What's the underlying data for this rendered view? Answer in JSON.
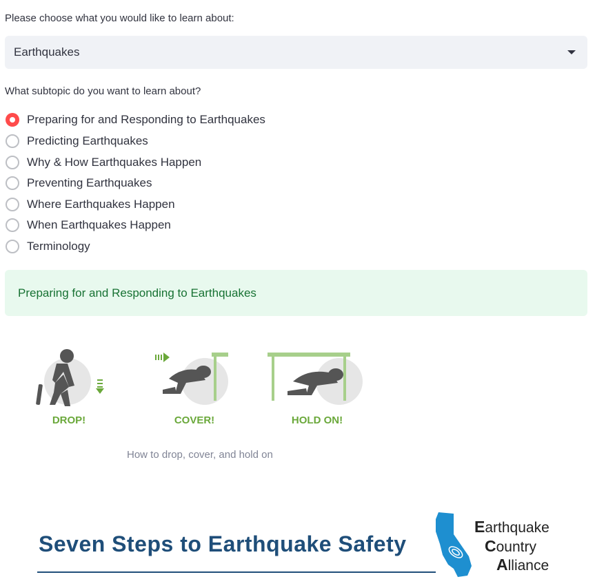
{
  "topic_select": {
    "label": "Please choose what you would like to learn about:",
    "value": "Earthquakes"
  },
  "subtopic": {
    "label": "What subtopic do you want to learn about?",
    "options": [
      "Preparing for and Responding to Earthquakes",
      "Predicting Earthquakes",
      "Why & How Earthquakes Happen",
      "Preventing Earthquakes",
      "Where Earthquakes Happen",
      "When Earthquakes Happen",
      "Terminology"
    ],
    "selected": "Preparing for and Responding to Earthquakes"
  },
  "success_message": "Preparing for and Responding to Earthquakes",
  "dch_image": {
    "labels": [
      "DROP!",
      "COVER!",
      "HOLD ON!"
    ],
    "caption": "How to drop, cover, and hold on"
  },
  "banner": {
    "title": "Seven Steps to Earthquake Safety",
    "logo": {
      "line1_initial": "E",
      "line1_rest": "arthquake",
      "line2_initial": "C",
      "line2_rest": "ountry",
      "line3_initial": "A",
      "line3_rest": "lliance"
    }
  },
  "colors": {
    "accent": "#ff4b4b",
    "success_bg": "#e8f9ee",
    "success_text": "#177233",
    "illustration_green": "#6aa83a",
    "banner_blue": "#1f4e79"
  }
}
